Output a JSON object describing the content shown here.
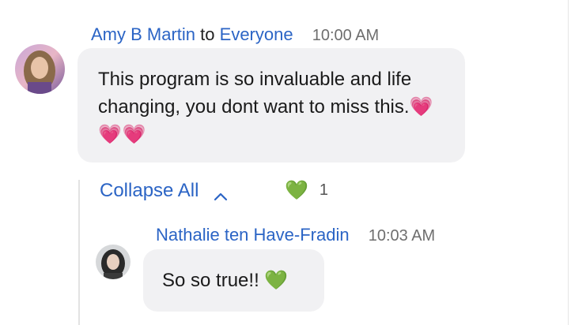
{
  "messages": [
    {
      "sender": "Amy B Martin",
      "to_word": "to",
      "recipient": "Everyone",
      "time": "10:00 AM",
      "text": "This program is so invaluable and life changing, you dont want to miss this.",
      "emoji": "💗💗💗"
    }
  ],
  "thread": {
    "collapse_label": "Collapse All",
    "reaction": {
      "emoji": "💚",
      "count": "1"
    },
    "replies": [
      {
        "sender": "Nathalie ten Have-Fradin",
        "time": "10:03 AM",
        "text": "So so true!!",
        "emoji": "💚"
      }
    ]
  },
  "icons": {
    "collapse": "chevron-up-icon",
    "avatar_amy": "avatar-photo",
    "avatar_nathalie": "avatar-photo"
  },
  "colors": {
    "link_blue": "#2b64c5",
    "bubble_bg": "#f1f1f3",
    "time_gray": "#6e6e6e"
  }
}
